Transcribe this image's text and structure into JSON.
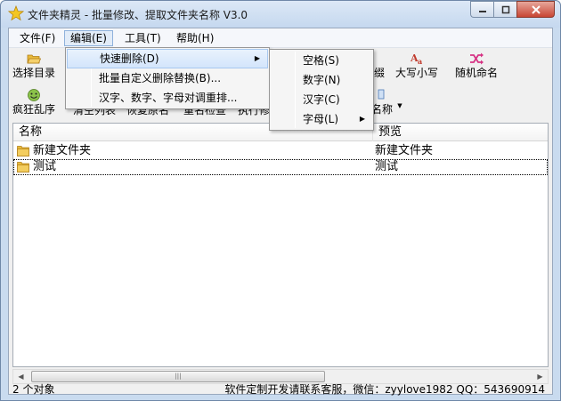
{
  "window": {
    "title": "文件夹精灵 - 批量修改、提取文件夹名称 V3.0"
  },
  "menubar": {
    "items": [
      {
        "label": "文件(F)"
      },
      {
        "label": "编辑(E)"
      },
      {
        "label": "工具(T)"
      },
      {
        "label": "帮助(H)"
      }
    ]
  },
  "toolbar": {
    "row1": [
      {
        "label": "选择目录",
        "icon": "open-folder-icon"
      },
      {
        "label": "缀",
        "icon": "suffix-icon"
      },
      {
        "label": "大写小写",
        "icon": "case-icon"
      },
      {
        "label": "随机命名",
        "icon": "shuffle-icon"
      }
    ],
    "row2": [
      {
        "label": "疯狂乱序",
        "icon": "smiley-icon"
      },
      {
        "label": "清空列表"
      },
      {
        "label": "恢复原名"
      },
      {
        "label": "重名检查"
      },
      {
        "label": "执行修"
      },
      {
        "label": "名称"
      }
    ]
  },
  "edit_menu": {
    "items": [
      {
        "label": "快速删除(D)",
        "submenu": true
      },
      {
        "label": "批量自定义删除替换(B)..."
      },
      {
        "label": "汉字、数字、字母对调重排..."
      }
    ]
  },
  "quick_delete_menu": {
    "items": [
      {
        "label": "空格(S)"
      },
      {
        "label": "数字(N)"
      },
      {
        "label": "汉字(C)"
      },
      {
        "label": "字母(L)",
        "submenu": true
      }
    ]
  },
  "list": {
    "columns": [
      {
        "label": "名称"
      },
      {
        "label": "预览"
      }
    ],
    "rows": [
      {
        "name": "新建文件夹",
        "preview": "新建文件夹"
      },
      {
        "name": "测试",
        "preview": "测试"
      }
    ]
  },
  "statusbar": {
    "left": "2 个对象",
    "right": "软件定制开发请联系客服，微信：zyylove1982  QQ：543690914"
  },
  "colors": {
    "folder": "#e8b93a",
    "menu_hover": "#d3e5fb",
    "close_button": "#c84634"
  }
}
